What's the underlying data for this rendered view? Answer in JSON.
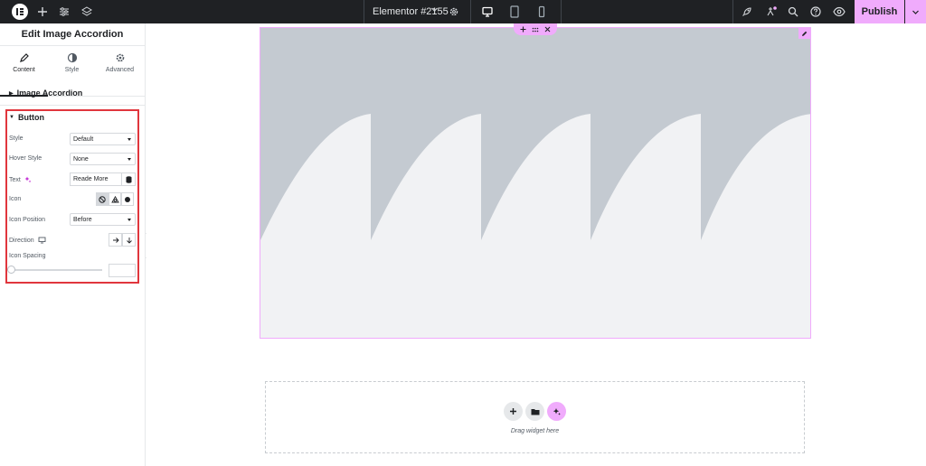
{
  "topbar": {
    "document_title": "Elementor #2155",
    "publish_label": "Publish",
    "icons": [
      "elementor-logo-icon",
      "plus-icon",
      "sliders-icon",
      "layers-icon",
      "chevron-down-icon",
      "gear-icon",
      "desktop-icon",
      "tablet-icon",
      "mobile-icon",
      "rocket-icon",
      "sparkle-icon",
      "search-icon",
      "help-icon",
      "eye-icon"
    ]
  },
  "panel": {
    "title": "Edit Image Accordion",
    "tabs": [
      {
        "label": "Content",
        "icon": "pencil-icon",
        "active": true
      },
      {
        "label": "Style",
        "icon": "contrast-icon",
        "active": false
      },
      {
        "label": "Advanced",
        "icon": "gear-icon",
        "active": false
      }
    ],
    "sections": {
      "image_accordion": "Image Accordion",
      "button": "Button"
    },
    "controls": {
      "style_label": "Style",
      "style_value": "Default",
      "hover_style_label": "Hover Style",
      "hover_style_value": "None",
      "text_label": "Text",
      "text_value": "Reade More",
      "icon_label": "Icon",
      "icon_position_label": "Icon Position",
      "icon_position_value": "Before",
      "direction_label": "Direction",
      "icon_spacing_label": "Icon Spacing",
      "icon_spacing_value": "",
      "icon_spacing_level": 0
    }
  },
  "canvas": {
    "dropzone_text": "Drag widget here",
    "placeholder_colors": {
      "background": "#f1f2f4",
      "shape": "#c4cad1"
    }
  },
  "colors": {
    "accent": "#f0abfc",
    "topbar": "#1f2124",
    "highlight_border": "#e0363d"
  }
}
